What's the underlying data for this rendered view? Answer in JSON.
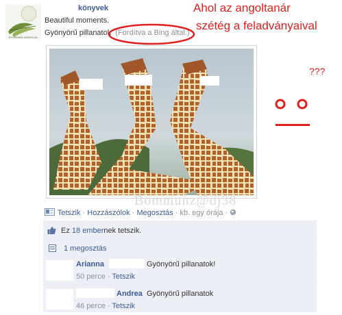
{
  "post": {
    "author_suffix": "könyvek",
    "logo_caption": "GYORSAN ANGOLUL",
    "line1": "Beautiful moments.",
    "line2": "Gyönyörű pillanatok",
    "translated_note": "(Fordítva a Bing által.)"
  },
  "annotation": {
    "title_line1": "Ahol az angoltanár",
    "title_line2": "szétég a feladványaival",
    "question": "???"
  },
  "watermark": "Bommunz@dj38",
  "actions": {
    "like": "Tetszik",
    "comment": "Hozzászólok",
    "share": "Megosztás",
    "time": "kb. egy órája"
  },
  "likes": {
    "prefix": "Ez ",
    "people_link": "18 ember",
    "suffix": "nek tetszik."
  },
  "shares": {
    "label": "1 megosztás"
  },
  "comments": [
    {
      "author": "Arianna",
      "text": "Gyönyörű pillanatok!",
      "time": "50 perce",
      "like": "Tetszik"
    },
    {
      "author": "Andrea",
      "text": "Gyönyörű pillanatok",
      "time": "46 perce",
      "like": "Tetszik"
    }
  ],
  "colors": {
    "fb_blue": "#3b5998",
    "annotation_red": "#e0201f",
    "panel_bg": "#eceff5"
  }
}
